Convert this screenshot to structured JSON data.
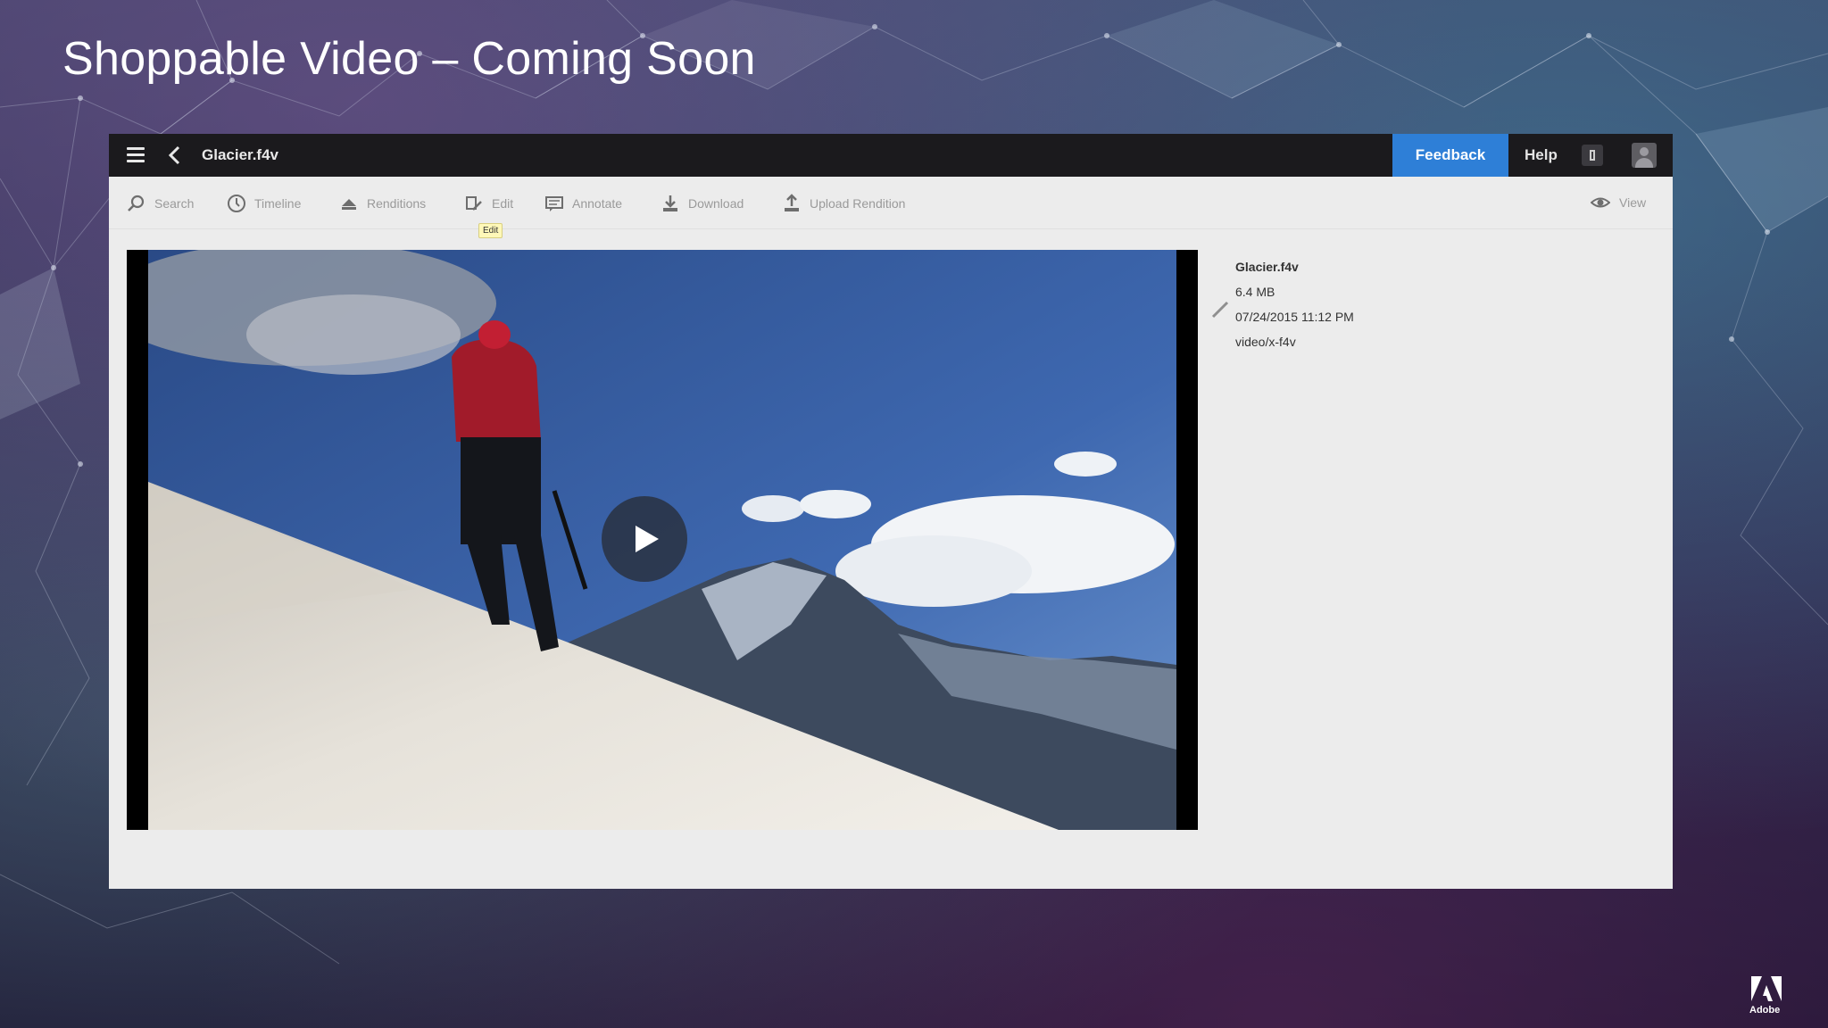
{
  "slide": {
    "title": "Shoppable Video – Coming Soon"
  },
  "app": {
    "topbar": {
      "file_name": "Glacier.f4v",
      "feedback_label": "Feedback",
      "help_label": "Help",
      "feedback_color": "#2e7fd7"
    },
    "toolbar": {
      "items": [
        {
          "label": "Search",
          "icon": "search-icon"
        },
        {
          "label": "Timeline",
          "icon": "clock-icon"
        },
        {
          "label": "Renditions",
          "icon": "renditions-icon"
        },
        {
          "label": "Edit",
          "icon": "edit-icon"
        },
        {
          "label": "Annotate",
          "icon": "annotate-icon"
        },
        {
          "label": "Download",
          "icon": "download-icon"
        },
        {
          "label": "Upload Rendition",
          "icon": "upload-icon"
        }
      ],
      "tooltip": "Edit",
      "view_label": "View"
    },
    "metadata": {
      "name": "Glacier.f4v",
      "size": "6.4 MB",
      "date": "07/24/2015 11:12 PM",
      "mime": "video/x-f4v"
    }
  },
  "brand": {
    "logo_text": "Adobe"
  }
}
